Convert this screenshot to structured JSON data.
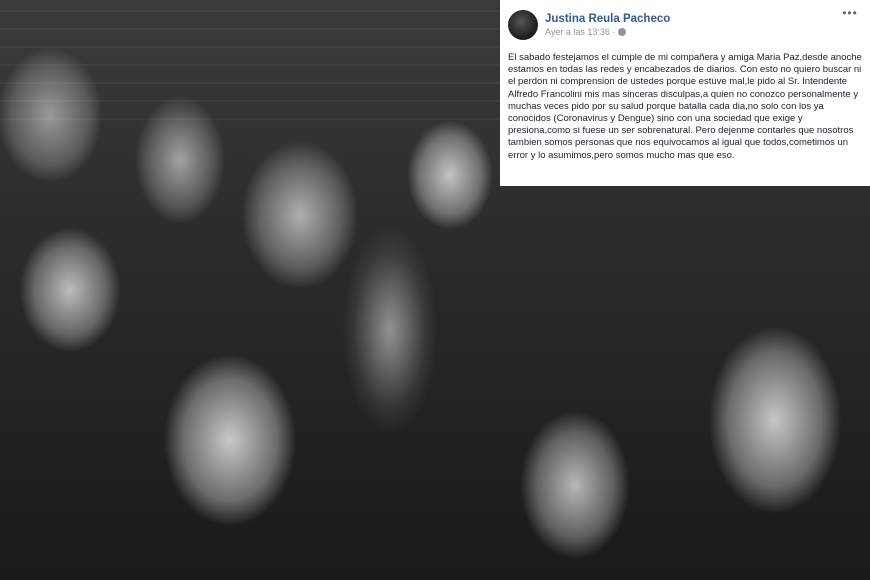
{
  "post": {
    "author": "Justina Reula Pacheco",
    "timestamp": "Ayer a las 13:36 ·",
    "privacy_icon": "globe-icon",
    "more_icon": "more-horizontal-icon",
    "body": "El sabado festejamos el cumple de mi compañera y amiga Maria Paz,desde anoche estamos en todas las redes y encabezados de diarios. Con esto no quiero buscar ni el perdon ni comprension de ustedes porque estuve mal,le pido al Sr. Intendente Alfredo Francolini mis mas sinceras disculpas,a quien no conozco personalmente y muchas veces pido por su salud porque batalla cada dia,no solo con los ya conocidos (Coronavirus y Dengue) sino con una sociedad que exige y presiona,como si fuese un ser sobrenatural. Pero dejenme contarles que nosotros tambien somos personas que nos equivocamos al igual que todos,cometimos un error y lo asumimos,pero somos mucho mas que eso."
  },
  "colors": {
    "author_link": "#365899",
    "meta_text": "#90949c",
    "post_background": "#ffffff"
  }
}
